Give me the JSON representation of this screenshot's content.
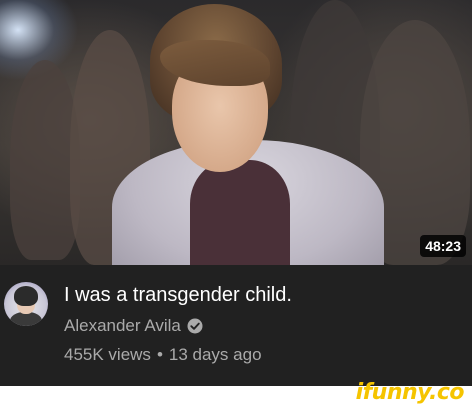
{
  "video": {
    "duration": "48:23",
    "title": "I was a transgender child.",
    "channel": "Alexander Avila",
    "verified": true,
    "views": "455K views",
    "separator": "•",
    "age": "13 days ago"
  },
  "watermark": "ifunny.co",
  "colors": {
    "background": "#212121",
    "title": "#ffffff",
    "secondary_text": "#aaaaaa",
    "watermark": "#f5c400"
  },
  "icons": {
    "verified": "verified-check-icon"
  }
}
